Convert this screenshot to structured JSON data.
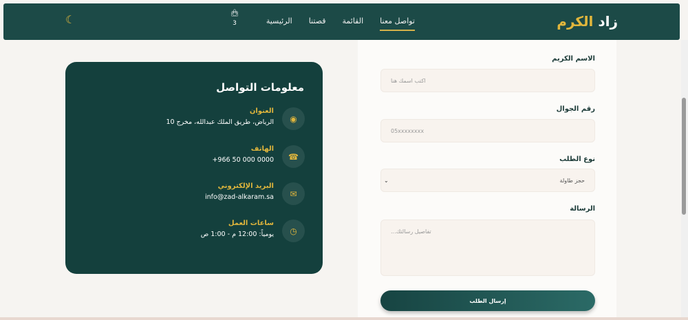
{
  "header": {
    "logo_main": "زاد ",
    "logo_accent": "الكرم",
    "nav": [
      "الرئيسية",
      "قصتنا",
      "القائمة",
      "تواصل معنا"
    ],
    "cart_count": "3"
  },
  "contact": {
    "title": "معلومات التواصل",
    "items": [
      {
        "icon": "map-pin-icon",
        "title": "العنوان",
        "value": "الرياض، طريق الملك عبدالله، مخرج 10"
      },
      {
        "icon": "phone-icon",
        "title": "الهاتف",
        "value": "+966 50 000 0000"
      },
      {
        "icon": "envelope-icon",
        "title": "البريد الإلكتروني",
        "value": "info@zad-alkaram.sa"
      },
      {
        "icon": "clock-icon",
        "title": "ساعات العمل",
        "value": "يومياً: 12:00 م - 1:00 ص"
      }
    ]
  },
  "form": {
    "name_label": "الاسم الكريم",
    "name_placeholder": "اكتب اسمك هنا",
    "phone_label": "رقم الجوال",
    "phone_placeholder": "05xxxxxxxx",
    "type_label": "نوع الطلب",
    "type_value": "حجز طاولة",
    "message_label": "الرسالة",
    "message_placeholder": "تفاصيل رسالتك...",
    "submit": "إرسال الطلب"
  }
}
